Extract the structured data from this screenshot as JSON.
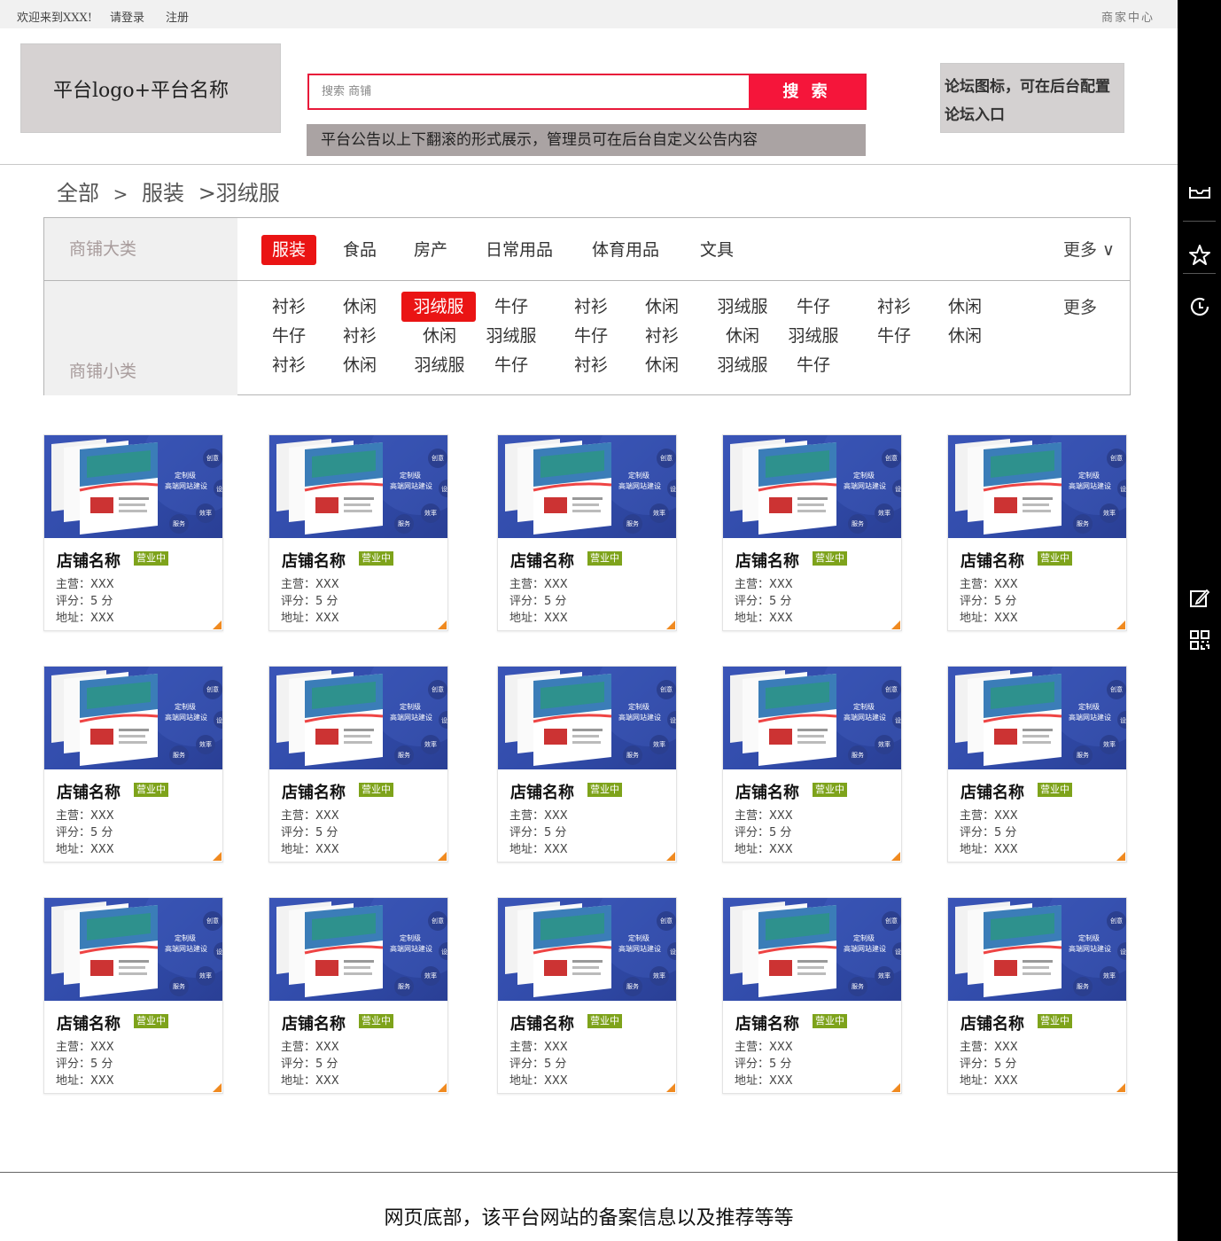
{
  "topbar": {
    "welcome": "欢迎来到XXX!",
    "login": "请登录",
    "register": "注册",
    "merchant_center": "商家中心"
  },
  "header": {
    "logo_text": "平台logo+平台名称",
    "search_placeholder": "搜索 商铺",
    "search_button": "搜 索",
    "notice": "平台公告以上下翻滚的形式展示，管理员可在后台自定义公告内容",
    "forum_line1": "论坛图标，可在后台配置",
    "forum_line2": "论坛入口"
  },
  "breadcrumb": [
    "全部",
    ">",
    "服装",
    ">羽绒服"
  ],
  "filter": {
    "big_label": "商铺大类",
    "small_label": "商铺小类",
    "big_categories": [
      {
        "label": "服装",
        "active": true
      },
      {
        "label": "食品",
        "active": false
      },
      {
        "label": "房产",
        "active": false
      },
      {
        "label": "日常用品",
        "active": false
      },
      {
        "label": "体育用品",
        "active": false
      },
      {
        "label": "文具",
        "active": false
      }
    ],
    "big_more": "更多 ∨",
    "small_more": "更多",
    "small_rows": [
      [
        "衬衫",
        "休闲",
        "羽绒服",
        "牛仔",
        "衬衫",
        "休闲",
        "羽绒服",
        "牛仔",
        "衬衫",
        "休闲"
      ],
      [
        "牛仔",
        "衬衫",
        "休闲",
        "羽绒服",
        "牛仔",
        "衬衫",
        "休闲",
        "羽绒服",
        "牛仔",
        "休闲"
      ],
      [
        "衬衫",
        "休闲",
        "羽绒服",
        "牛仔",
        "衬衫",
        "休闲",
        "羽绒服",
        "牛仔"
      ]
    ],
    "small_active": [
      0,
      2
    ]
  },
  "shop_card": {
    "name": "店铺名称",
    "status": "营业中",
    "main": "主营：XXX",
    "rating": "评分：5 分",
    "address": "地址：XXX",
    "thumb_text1": "定制级",
    "thumb_text2": "高端网站建设",
    "thumb_tag1": "创意",
    "thumb_tag2": "效率",
    "thumb_tag3": "服务",
    "thumb_tag4": "设"
  },
  "shop_count": 15,
  "footer": "网页底部，该平台网站的备案信息以及推荐等等",
  "colors": {
    "accent": "#f5153a",
    "active_tag": "#ea1414",
    "status_green": "#7ea31b",
    "corner_orange": "#f08a20",
    "sidebar": "#000000"
  },
  "rail_icons": [
    "inbox-icon",
    "star-icon",
    "history-icon",
    "edit-icon",
    "qrcode-icon"
  ]
}
